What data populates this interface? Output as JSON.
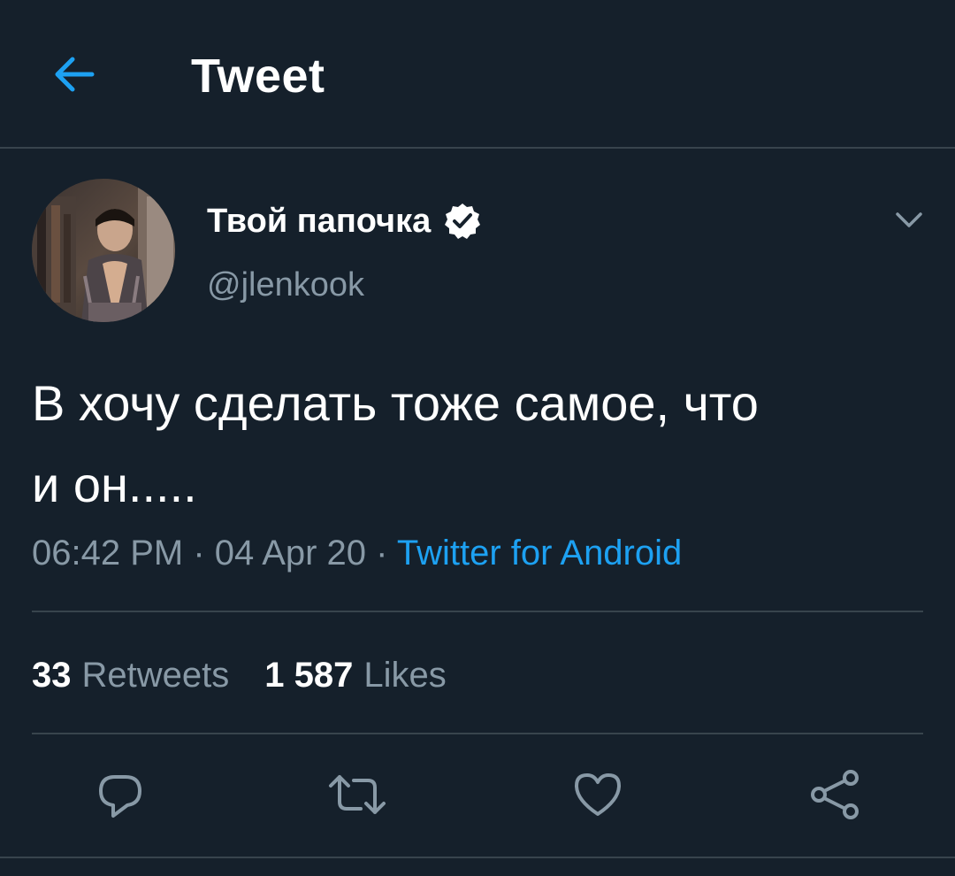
{
  "header": {
    "title": "Tweet",
    "back_icon": "arrow-left-icon"
  },
  "author": {
    "display_name": "Твой папочка",
    "username": "@jlenkook",
    "verified": true,
    "avatar": "profile-photo"
  },
  "tweet": {
    "text": "В хочу сделать тоже самое, что\nи он.....",
    "time": "06:42 PM",
    "separator": "·",
    "date": "04 Apr 20",
    "source": "Twitter for Android"
  },
  "stats": {
    "retweets_count": "33",
    "retweets_label": "Retweets",
    "likes_count": "1 587",
    "likes_label": "Likes"
  },
  "actions": [
    "reply-icon",
    "retweet-icon",
    "like-icon",
    "share-icon"
  ],
  "colors": {
    "background": "#15202b",
    "accent": "#1da1f2",
    "secondary_text": "#8899a6",
    "divider": "#38444d"
  }
}
